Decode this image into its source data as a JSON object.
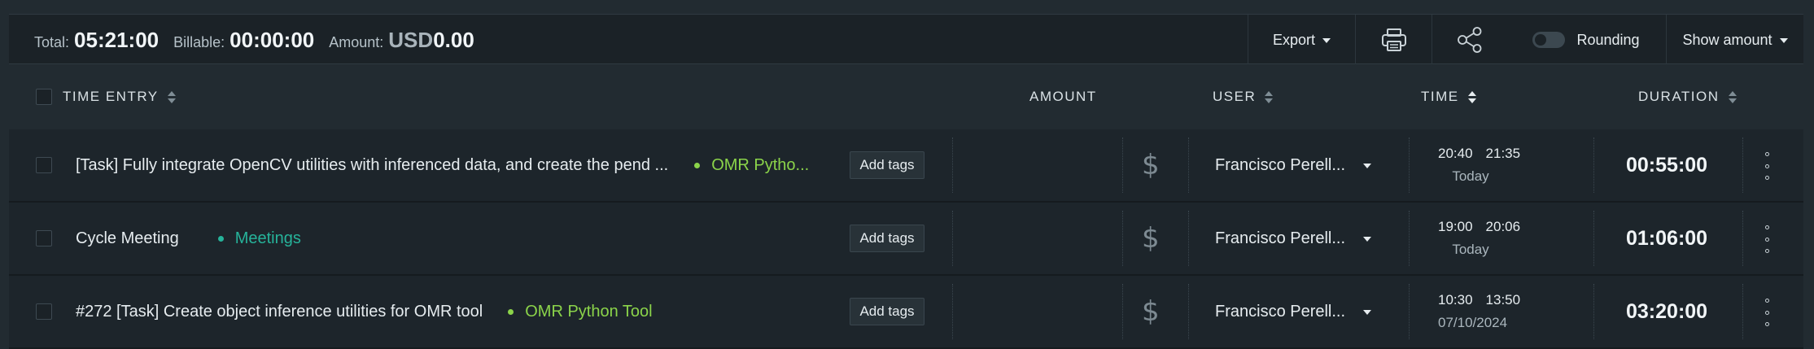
{
  "summary": {
    "total_label": "Total:",
    "total_value": "05:21:00",
    "billable_label": "Billable:",
    "billable_value": "00:00:00",
    "amount_label": "Amount:",
    "amount_currency": "USD",
    "amount_value": "0.00"
  },
  "toolbar": {
    "export_label": "Export",
    "print_icon": "printer-icon",
    "share_icon": "share-icon",
    "rounding_label": "Rounding",
    "rounding_on": false,
    "show_amount_label": "Show amount"
  },
  "columns": {
    "time_entry": "TIME ENTRY",
    "amount": "AMOUNT",
    "user": "USER",
    "time": "TIME",
    "duration": "DURATION"
  },
  "entries": [
    {
      "description": "[Task] Fully integrate OpenCV utilities with inferenced data, and create the pend ...",
      "project": "OMR Pytho...",
      "project_color": "#8bd44a",
      "tags_button": "Add tags",
      "billable_icon": "dollar-icon",
      "user": "Francisco Perell...",
      "start": "20:40",
      "end": "21:35",
      "date": "Today",
      "duration": "00:55:00"
    },
    {
      "description": "Cycle Meeting",
      "project": "Meetings",
      "project_color": "#26b39a",
      "tags_button": "Add tags",
      "billable_icon": "dollar-icon",
      "user": "Francisco Perell...",
      "start": "19:00",
      "end": "20:06",
      "date": "Today",
      "duration": "01:06:00"
    },
    {
      "description": "#272 [Task] Create object inference utilities for OMR tool",
      "project": "OMR Python Tool",
      "project_color": "#8bd44a",
      "tags_button": "Add tags",
      "billable_icon": "dollar-icon",
      "user": "Francisco Perell...",
      "start": "10:30",
      "end": "13:50",
      "date": "07/10/2024",
      "duration": "03:20:00"
    }
  ]
}
